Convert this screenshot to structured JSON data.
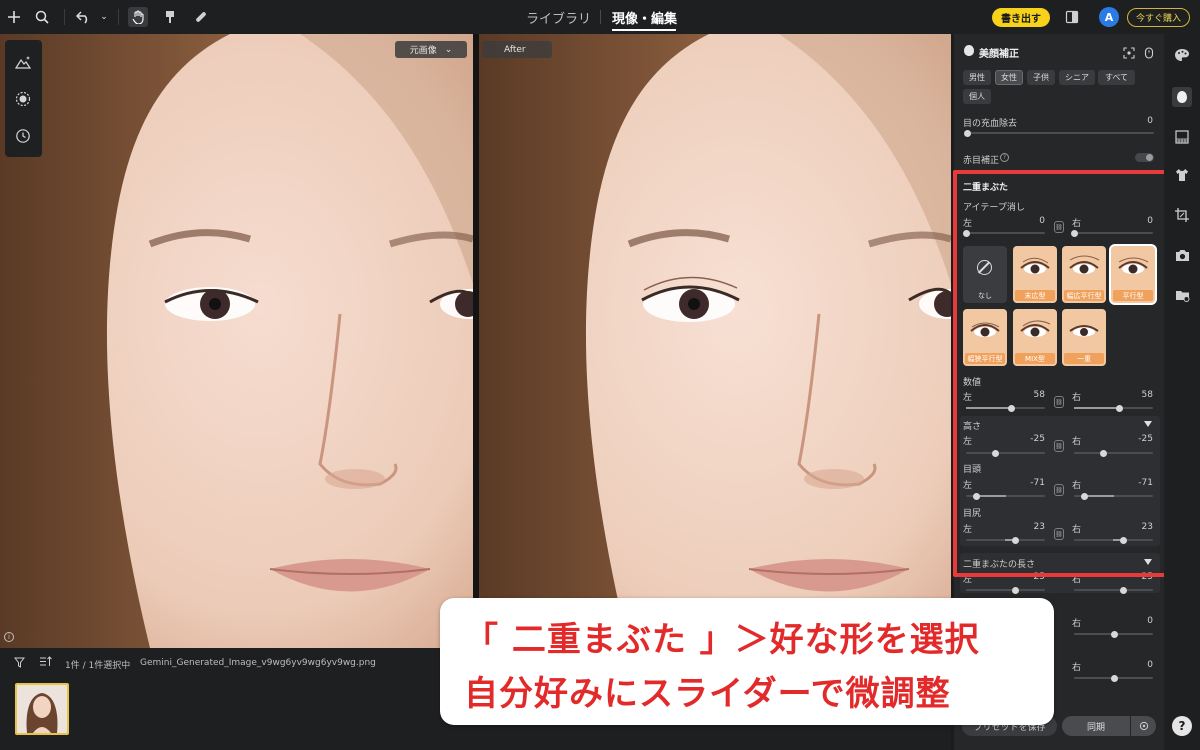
{
  "topbar": {
    "tab_library": "ライブラリ",
    "tab_develop": "現像・編集",
    "export_label": "書き出す",
    "avatar_initial": "A",
    "buy_label": "今すぐ購入"
  },
  "viewer": {
    "original_select": "元画像",
    "after_label": "After"
  },
  "filmstrip": {
    "select_count": "1件 / 1件選択中",
    "file_name": "Gemini_Generated_Image_v9wg6yv9wg6yv9wg.png"
  },
  "panel": {
    "title": "美顔補正",
    "gender_chips": [
      "男性",
      "女性",
      "子供",
      "シニア",
      "すべて",
      "個人"
    ],
    "active_chip": "女性",
    "eye_redness_label": "目の充血除去",
    "eye_redness_value": "0",
    "eye_redness_level": 0,
    "red_eye_label": "赤目補正",
    "section_title": "二重まぶた",
    "eyetape_label": "アイテープ消し",
    "left_label": "左",
    "right_label": "右",
    "eyetape_left": "0",
    "eyetape_right": "0",
    "presets": [
      "なし",
      "末広型",
      "幅広平行型",
      "平行型",
      "幅狭平行型",
      "MIX型",
      "一重"
    ],
    "selected_preset": "平行型",
    "amount_label": "数値",
    "amount_left": "58",
    "amount_right": "58",
    "height_label": "高さ",
    "height_left": "-25",
    "height_right": "-25",
    "inner_label": "目頭",
    "inner_left": "-71",
    "inner_right": "-71",
    "outer_label": "目尻",
    "outer_left": "23",
    "outer_right": "23",
    "length_label": "二重まぶたの長さ",
    "length_left": "25",
    "length_right": "25",
    "extra_right_1": "0",
    "extra_right_2": "0",
    "save_preset_label": "プリセットを保存",
    "sync_label": "同期",
    "help_label": "?"
  },
  "callout": {
    "line1": "「 二重まぶた 」＞好な形を選択",
    "line2": "自分好みにスライダーで微調整"
  },
  "colors": {
    "accent_yellow": "#f6d21b",
    "highlight_red": "#e83a3a",
    "preset_orange": "#f0a25d",
    "avatar_blue": "#2b7be6"
  }
}
